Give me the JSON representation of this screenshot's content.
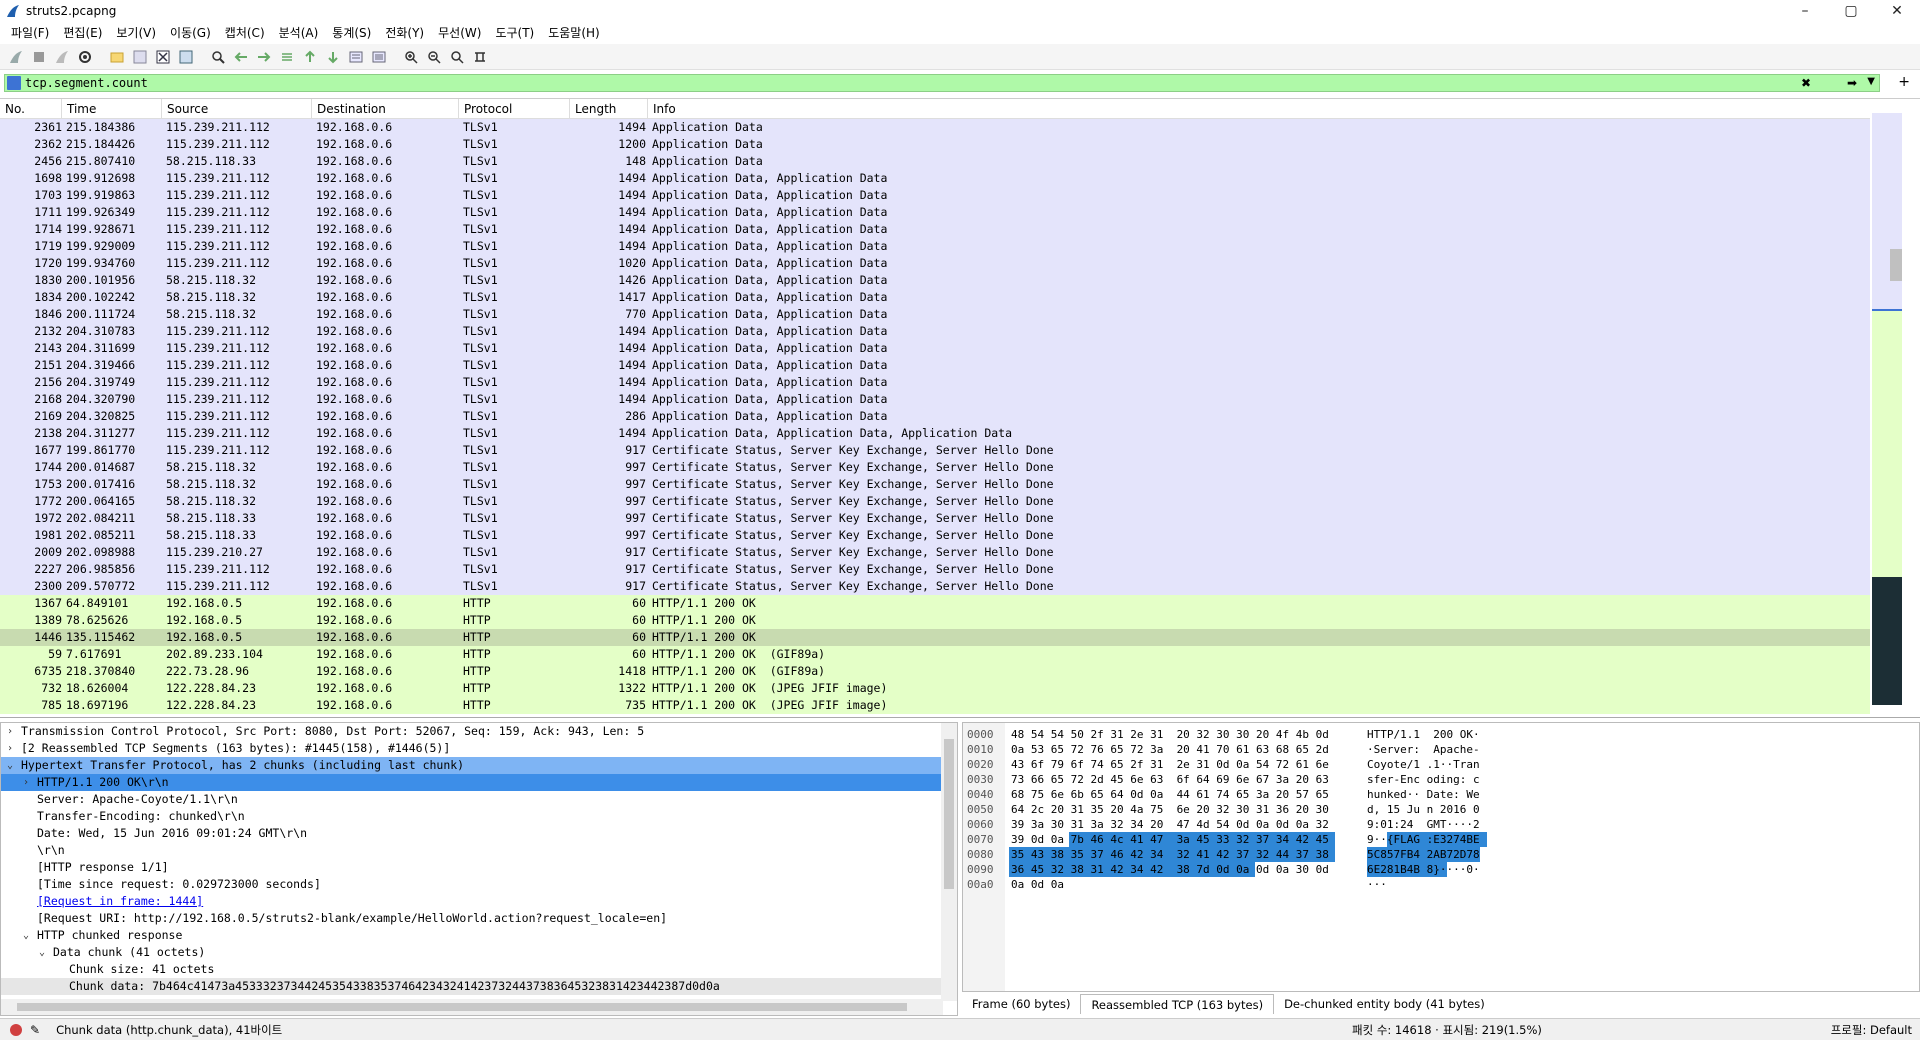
{
  "window": {
    "title": "struts2.pcapng",
    "controls": [
      "–",
      "▢",
      "✕"
    ]
  },
  "menu": [
    "파일(F)",
    "편집(E)",
    "보기(V)",
    "이동(G)",
    "캡처(C)",
    "분석(A)",
    "통계(S)",
    "전화(Y)",
    "무선(W)",
    "도구(T)",
    "도움말(H)"
  ],
  "toolbar_icons": [
    "shark-fin-start-icon",
    "stop-icon",
    "restart-icon",
    "options-gear-icon",
    "open-folder-icon",
    "save-icon",
    "close-file-icon",
    "reload-icon",
    "find-icon",
    "back-arrow-icon",
    "forward-arrow-icon",
    "go-to-packet-icon",
    "first-packet-icon",
    "last-packet-icon",
    "autoscroll-icon",
    "colorize-icon",
    "zoom-in-icon",
    "zoom-out-icon",
    "zoom-normal-icon",
    "resize-columns-icon"
  ],
  "filter": {
    "value": "tcp.segment.count",
    "bg_color": "#aff9a8"
  },
  "packet_list": {
    "columns": [
      "No.",
      "Time",
      "Source",
      "Destination",
      "Protocol",
      "Length",
      "Info"
    ],
    "rows": [
      {
        "no": "2361",
        "time": "215.184386",
        "src": "115.239.211.112",
        "dst": "192.168.0.6",
        "proto": "TLSv1",
        "len": "1494",
        "info": "Application Data",
        "kind": "tls"
      },
      {
        "no": "2362",
        "time": "215.184426",
        "src": "115.239.211.112",
        "dst": "192.168.0.6",
        "proto": "TLSv1",
        "len": "1200",
        "info": "Application Data",
        "kind": "tls"
      },
      {
        "no": "2456",
        "time": "215.807410",
        "src": "58.215.118.33",
        "dst": "192.168.0.6",
        "proto": "TLSv1",
        "len": "148",
        "info": "Application Data",
        "kind": "tls"
      },
      {
        "no": "1698",
        "time": "199.912698",
        "src": "115.239.211.112",
        "dst": "192.168.0.6",
        "proto": "TLSv1",
        "len": "1494",
        "info": "Application Data, Application Data",
        "kind": "tls"
      },
      {
        "no": "1703",
        "time": "199.919863",
        "src": "115.239.211.112",
        "dst": "192.168.0.6",
        "proto": "TLSv1",
        "len": "1494",
        "info": "Application Data, Application Data",
        "kind": "tls"
      },
      {
        "no": "1711",
        "time": "199.926349",
        "src": "115.239.211.112",
        "dst": "192.168.0.6",
        "proto": "TLSv1",
        "len": "1494",
        "info": "Application Data, Application Data",
        "kind": "tls"
      },
      {
        "no": "1714",
        "time": "199.928671",
        "src": "115.239.211.112",
        "dst": "192.168.0.6",
        "proto": "TLSv1",
        "len": "1494",
        "info": "Application Data, Application Data",
        "kind": "tls"
      },
      {
        "no": "1719",
        "time": "199.929009",
        "src": "115.239.211.112",
        "dst": "192.168.0.6",
        "proto": "TLSv1",
        "len": "1494",
        "info": "Application Data, Application Data",
        "kind": "tls"
      },
      {
        "no": "1720",
        "time": "199.934760",
        "src": "115.239.211.112",
        "dst": "192.168.0.6",
        "proto": "TLSv1",
        "len": "1020",
        "info": "Application Data, Application Data",
        "kind": "tls"
      },
      {
        "no": "1830",
        "time": "200.101956",
        "src": "58.215.118.32",
        "dst": "192.168.0.6",
        "proto": "TLSv1",
        "len": "1426",
        "info": "Application Data, Application Data",
        "kind": "tls"
      },
      {
        "no": "1834",
        "time": "200.102242",
        "src": "58.215.118.32",
        "dst": "192.168.0.6",
        "proto": "TLSv1",
        "len": "1417",
        "info": "Application Data, Application Data",
        "kind": "tls"
      },
      {
        "no": "1846",
        "time": "200.111724",
        "src": "58.215.118.32",
        "dst": "192.168.0.6",
        "proto": "TLSv1",
        "len": "770",
        "info": "Application Data, Application Data",
        "kind": "tls"
      },
      {
        "no": "2132",
        "time": "204.310783",
        "src": "115.239.211.112",
        "dst": "192.168.0.6",
        "proto": "TLSv1",
        "len": "1494",
        "info": "Application Data, Application Data",
        "kind": "tls"
      },
      {
        "no": "2143",
        "time": "204.311699",
        "src": "115.239.211.112",
        "dst": "192.168.0.6",
        "proto": "TLSv1",
        "len": "1494",
        "info": "Application Data, Application Data",
        "kind": "tls"
      },
      {
        "no": "2151",
        "time": "204.319466",
        "src": "115.239.211.112",
        "dst": "192.168.0.6",
        "proto": "TLSv1",
        "len": "1494",
        "info": "Application Data, Application Data",
        "kind": "tls"
      },
      {
        "no": "2156",
        "time": "204.319749",
        "src": "115.239.211.112",
        "dst": "192.168.0.6",
        "proto": "TLSv1",
        "len": "1494",
        "info": "Application Data, Application Data",
        "kind": "tls"
      },
      {
        "no": "2168",
        "time": "204.320790",
        "src": "115.239.211.112",
        "dst": "192.168.0.6",
        "proto": "TLSv1",
        "len": "1494",
        "info": "Application Data, Application Data",
        "kind": "tls"
      },
      {
        "no": "2169",
        "time": "204.320825",
        "src": "115.239.211.112",
        "dst": "192.168.0.6",
        "proto": "TLSv1",
        "len": "286",
        "info": "Application Data, Application Data",
        "kind": "tls"
      },
      {
        "no": "2138",
        "time": "204.311277",
        "src": "115.239.211.112",
        "dst": "192.168.0.6",
        "proto": "TLSv1",
        "len": "1494",
        "info": "Application Data, Application Data, Application Data",
        "kind": "tls"
      },
      {
        "no": "1677",
        "time": "199.861770",
        "src": "115.239.211.112",
        "dst": "192.168.0.6",
        "proto": "TLSv1",
        "len": "917",
        "info": "Certificate Status, Server Key Exchange, Server Hello Done",
        "kind": "tls"
      },
      {
        "no": "1744",
        "time": "200.014687",
        "src": "58.215.118.32",
        "dst": "192.168.0.6",
        "proto": "TLSv1",
        "len": "997",
        "info": "Certificate Status, Server Key Exchange, Server Hello Done",
        "kind": "tls"
      },
      {
        "no": "1753",
        "time": "200.017416",
        "src": "58.215.118.32",
        "dst": "192.168.0.6",
        "proto": "TLSv1",
        "len": "997",
        "info": "Certificate Status, Server Key Exchange, Server Hello Done",
        "kind": "tls"
      },
      {
        "no": "1772",
        "time": "200.064165",
        "src": "58.215.118.32",
        "dst": "192.168.0.6",
        "proto": "TLSv1",
        "len": "997",
        "info": "Certificate Status, Server Key Exchange, Server Hello Done",
        "kind": "tls"
      },
      {
        "no": "1972",
        "time": "202.084211",
        "src": "58.215.118.33",
        "dst": "192.168.0.6",
        "proto": "TLSv1",
        "len": "997",
        "info": "Certificate Status, Server Key Exchange, Server Hello Done",
        "kind": "tls"
      },
      {
        "no": "1981",
        "time": "202.085211",
        "src": "58.215.118.33",
        "dst": "192.168.0.6",
        "proto": "TLSv1",
        "len": "997",
        "info": "Certificate Status, Server Key Exchange, Server Hello Done",
        "kind": "tls"
      },
      {
        "no": "2009",
        "time": "202.098988",
        "src": "115.239.210.27",
        "dst": "192.168.0.6",
        "proto": "TLSv1",
        "len": "917",
        "info": "Certificate Status, Server Key Exchange, Server Hello Done",
        "kind": "tls"
      },
      {
        "no": "2227",
        "time": "206.985856",
        "src": "115.239.211.112",
        "dst": "192.168.0.6",
        "proto": "TLSv1",
        "len": "917",
        "info": "Certificate Status, Server Key Exchange, Server Hello Done",
        "kind": "tls"
      },
      {
        "no": "2300",
        "time": "209.570772",
        "src": "115.239.211.112",
        "dst": "192.168.0.6",
        "proto": "TLSv1",
        "len": "917",
        "info": "Certificate Status, Server Key Exchange, Server Hello Done",
        "kind": "tls"
      },
      {
        "no": "1367",
        "time": "64.849101",
        "src": "192.168.0.5",
        "dst": "192.168.0.6",
        "proto": "HTTP",
        "len": "60",
        "info": "HTTP/1.1 200 OK",
        "kind": "http"
      },
      {
        "no": "1389",
        "time": "78.625626",
        "src": "192.168.0.5",
        "dst": "192.168.0.6",
        "proto": "HTTP",
        "len": "60",
        "info": "HTTP/1.1 200 OK",
        "kind": "http"
      },
      {
        "no": "1446",
        "time": "135.115462",
        "src": "192.168.0.5",
        "dst": "192.168.0.6",
        "proto": "HTTP",
        "len": "60",
        "info": "HTTP/1.1 200 OK",
        "kind": "sel"
      },
      {
        "no": "59",
        "time": "7.617691",
        "src": "202.89.233.104",
        "dst": "192.168.0.6",
        "proto": "HTTP",
        "len": "60",
        "info": "HTTP/1.1 200 OK  (GIF89a)",
        "kind": "http"
      },
      {
        "no": "6735",
        "time": "218.370840",
        "src": "222.73.28.96",
        "dst": "192.168.0.6",
        "proto": "HTTP",
        "len": "1418",
        "info": "HTTP/1.1 200 OK  (GIF89a)",
        "kind": "http"
      },
      {
        "no": "732",
        "time": "18.626004",
        "src": "122.228.84.23",
        "dst": "192.168.0.6",
        "proto": "HTTP",
        "len": "1322",
        "info": "HTTP/1.1 200 OK  (JPEG JFIF image)",
        "kind": "http"
      },
      {
        "no": "785",
        "time": "18.697196",
        "src": "122.228.84.23",
        "dst": "192.168.0.6",
        "proto": "HTTP",
        "len": "735",
        "info": "HTTP/1.1 200 OK  (JPEG JFIF image)",
        "kind": "http"
      }
    ],
    "row_colors": {
      "tls": "#e4e4fb",
      "http": "#e4ffc7",
      "selected": "#c8dbb0"
    }
  },
  "details": [
    {
      "indent": 0,
      "exp": ">",
      "text": "Transmission Control Protocol, Src Port: 8080, Dst Port: 52067, Seq: 159, Ack: 943, Len: 5",
      "style": ""
    },
    {
      "indent": 0,
      "exp": ">",
      "text": "[2 Reassembled TCP Segments (163 bytes): #1445(158), #1446(5)]",
      "style": ""
    },
    {
      "indent": 0,
      "exp": "v",
      "text": "Hypertext Transfer Protocol, has 2 chunks (including last chunk)",
      "style": "hl"
    },
    {
      "indent": 1,
      "exp": ">",
      "text": "HTTP/1.1 200 OK\\r\\n",
      "style": "selchild"
    },
    {
      "indent": 1,
      "exp": "",
      "text": "Server: Apache-Coyote/1.1\\r\\n",
      "style": ""
    },
    {
      "indent": 1,
      "exp": "",
      "text": "Transfer-Encoding: chunked\\r\\n",
      "style": ""
    },
    {
      "indent": 1,
      "exp": "",
      "text": "Date: Wed, 15 Jun 2016 09:01:24 GMT\\r\\n",
      "style": ""
    },
    {
      "indent": 1,
      "exp": "",
      "text": "\\r\\n",
      "style": ""
    },
    {
      "indent": 1,
      "exp": "",
      "text": "[HTTP response 1/1]",
      "style": ""
    },
    {
      "indent": 1,
      "exp": "",
      "text": "[Time since request: 0.029723000 seconds]",
      "style": ""
    },
    {
      "indent": 1,
      "exp": "",
      "text": "[Request in frame: 1444]",
      "style": "link"
    },
    {
      "indent": 1,
      "exp": "",
      "text": "[Request URI: http://192.168.0.5/struts2-blank/example/HelloWorld.action?request_locale=en]",
      "style": ""
    },
    {
      "indent": 1,
      "exp": "v",
      "text": "HTTP chunked response",
      "style": ""
    },
    {
      "indent": 2,
      "exp": "v",
      "text": "Data chunk (41 octets)",
      "style": ""
    },
    {
      "indent": 3,
      "exp": "",
      "text": "Chunk size: 41 octets",
      "style": ""
    },
    {
      "indent": 3,
      "exp": "",
      "text": "Chunk data: 7b464c41473a45333237344245354338353746423432414237324437383645323831423442387d0d0a",
      "style": "datasel"
    }
  ],
  "bytes": {
    "offsets": [
      "0000",
      "0010",
      "0020",
      "0030",
      "0040",
      "0050",
      "0060",
      "0070",
      "0080",
      "0090",
      "00a0"
    ],
    "hex": [
      "48 54 54 50 2f 31 2e 31  20 32 30 30 20 4f 4b 0d",
      "0a 53 65 72 76 65 72 3a  20 41 70 61 63 68 65 2d",
      "43 6f 79 6f 74 65 2f 31  2e 31 0d 0a 54 72 61 6e",
      "73 66 65 72 2d 45 6e 63  6f 64 69 6e 67 3a 20 63",
      "68 75 6e 6b 65 64 0d 0a  44 61 74 65 3a 20 57 65",
      "64 2c 20 31 35 20 4a 75  6e 20 32 30 31 36 20 30",
      "39 3a 30 31 3a 32 34 20  47 4d 54 0d 0a 0d 0a 32",
      "39 0d 0a 7b 46 4c 41 47  3a 45 33 32 37 34 42 45",
      "35 43 38 35 37 46 42 34  32 41 42 37 32 44 37 38",
      "36 45 32 38 31 42 34 42  38 7d 0d 0a 0d 0a 30 0d",
      "0a 0d 0a"
    ],
    "ascii": [
      "HTTP/1.1  200 OK·",
      "·Server:  Apache-",
      "Coyote/1 .1··Tran",
      "sfer-Enc oding: c",
      "hunked·· Date: We",
      "d, 15 Ju n 2016 0",
      "9:01:24  GMT····2",
      "9··{FLAG :E3274BE",
      "5C857FB4 2AB72D78",
      "6E281B4B 8}····0·",
      "···"
    ],
    "tabs": [
      "Frame (60 bytes)",
      "Reassembled TCP (163 bytes)",
      "De-chunked entity body (41 bytes)"
    ],
    "highlight_color": "#2f87d6"
  },
  "status": {
    "field": "Chunk data (http.chunk_data), 41바이트",
    "counts": "패킷 수: 14618 · 표시됨: 219(1.5%)",
    "profile": "프로필: Default"
  }
}
